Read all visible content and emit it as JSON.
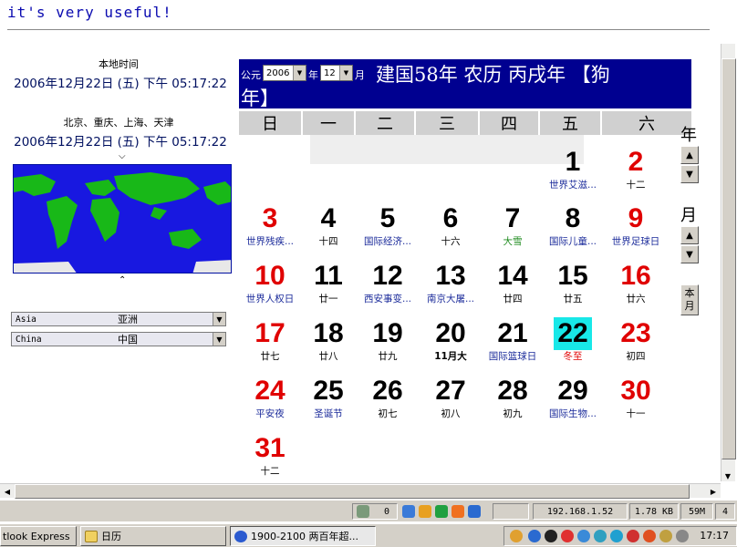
{
  "header": {
    "text": "it's very useful!"
  },
  "clocks": [
    {
      "label": "本地时间",
      "value": "2006年12月22日 (五) 下午 05:17:22"
    },
    {
      "label": "北京、重庆、上海、天津",
      "value": "2006年12月22日 (五) 下午 05:17:22"
    }
  ],
  "region_select": {
    "en": "Asia",
    "zh": "亚洲"
  },
  "country_select": {
    "en": "China",
    "zh": "中国"
  },
  "calendar": {
    "era_label": "公元",
    "year": "2006",
    "year_unit": "年",
    "month": "12",
    "month_unit": "月",
    "title": "建国58年 农历 丙戌年 【狗",
    "title_cont": "年】",
    "weekdays": [
      "日",
      "一",
      "二",
      "三",
      "四",
      "五",
      "六"
    ],
    "days": [
      {
        "n": "1",
        "sub": "世界艾滋...",
        "numc": "black",
        "subc": "holiday"
      },
      {
        "n": "2",
        "sub": "十二",
        "numc": "red",
        "subc": "plain"
      },
      {
        "n": "3",
        "sub": "世界残疾...",
        "numc": "red",
        "subc": "holiday"
      },
      {
        "n": "4",
        "sub": "十四",
        "numc": "black",
        "subc": "plain"
      },
      {
        "n": "5",
        "sub": "国际经济...",
        "numc": "black",
        "subc": "holiday"
      },
      {
        "n": "6",
        "sub": "十六",
        "numc": "black",
        "subc": "plain"
      },
      {
        "n": "7",
        "sub": "大雪",
        "numc": "black",
        "subc": "green"
      },
      {
        "n": "8",
        "sub": "国际儿童...",
        "numc": "black",
        "subc": "holiday"
      },
      {
        "n": "9",
        "sub": "世界足球日",
        "numc": "red",
        "subc": "holiday"
      },
      {
        "n": "10",
        "sub": "世界人权日",
        "numc": "red",
        "subc": "holiday"
      },
      {
        "n": "11",
        "sub": "廿一",
        "numc": "black",
        "subc": "plain"
      },
      {
        "n": "12",
        "sub": "西安事变...",
        "numc": "black",
        "subc": "holiday"
      },
      {
        "n": "13",
        "sub": "南京大屠...",
        "numc": "black",
        "subc": "holiday"
      },
      {
        "n": "14",
        "sub": "廿四",
        "numc": "black",
        "subc": "plain"
      },
      {
        "n": "15",
        "sub": "廿五",
        "numc": "black",
        "subc": "plain"
      },
      {
        "n": "16",
        "sub": "廿六",
        "numc": "red",
        "subc": "plain"
      },
      {
        "n": "17",
        "sub": "廿七",
        "numc": "red",
        "subc": "plain"
      },
      {
        "n": "18",
        "sub": "廿八",
        "numc": "black",
        "subc": "plain"
      },
      {
        "n": "19",
        "sub": "廿九",
        "numc": "black",
        "subc": "plain"
      },
      {
        "n": "20",
        "sub": "11月大",
        "numc": "black",
        "subc": "bold"
      },
      {
        "n": "21",
        "sub": "国际篮球日",
        "numc": "black",
        "subc": "holiday"
      },
      {
        "n": "22",
        "sub": "冬至",
        "numc": "black",
        "subc": "red",
        "today": true
      },
      {
        "n": "23",
        "sub": "初四",
        "numc": "red",
        "subc": "plain"
      },
      {
        "n": "24",
        "sub": "平安夜",
        "numc": "red",
        "subc": "holiday"
      },
      {
        "n": "25",
        "sub": "圣诞节",
        "numc": "black",
        "subc": "holiday"
      },
      {
        "n": "26",
        "sub": "初七",
        "numc": "black",
        "subc": "plain"
      },
      {
        "n": "27",
        "sub": "初八",
        "numc": "black",
        "subc": "plain"
      },
      {
        "n": "28",
        "sub": "初九",
        "numc": "black",
        "subc": "plain"
      },
      {
        "n": "29",
        "sub": "国际生物...",
        "numc": "black",
        "subc": "holiday"
      },
      {
        "n": "30",
        "sub": "十一",
        "numc": "red",
        "subc": "plain"
      },
      {
        "n": "31",
        "sub": "十二",
        "numc": "red",
        "subc": "plain"
      }
    ],
    "first_weekday": 5,
    "today": "22",
    "today_color": "#18e8e8",
    "header_bg": "#000090"
  },
  "controls": {
    "year_label": "年",
    "month_label": "月",
    "current_month_button": "本月",
    "up_icon": "triangle-up-icon",
    "down_icon": "triangle-down-icon"
  },
  "statusbar": {
    "count": "0",
    "ip": "192.168.1.52",
    "size": "1.78 KB",
    "mem": "59M",
    "extra": "4"
  },
  "taskbar": {
    "items": [
      "tlook Express",
      "日历",
      "1900-2100 两百年超..."
    ],
    "clock": "17:17"
  }
}
